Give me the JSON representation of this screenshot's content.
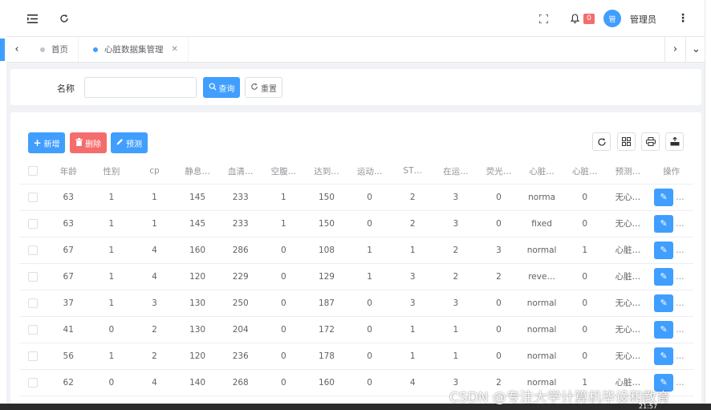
{
  "header": {
    "menu_icon": "hamburger-icon",
    "refresh_icon": "refresh-icon",
    "fullscreen_icon": "fullscreen-icon",
    "bell_icon": "bell-icon",
    "notification_count": "0",
    "avatar_text": "管",
    "username": "管理员",
    "more_icon": "vertical-dots-icon"
  },
  "tabs": [
    {
      "label": "首页",
      "active": false
    },
    {
      "label": "心脏数据集管理",
      "active": true
    }
  ],
  "search": {
    "label": "名称",
    "input_value": "",
    "input_placeholder": "",
    "query_button": "查询",
    "reset_button": "重置"
  },
  "toolbar": {
    "add_button": "新增",
    "delete_button": "删除",
    "predict_button": "预测"
  },
  "table": {
    "columns": [
      "年龄",
      "性别",
      "cp",
      "静息…",
      "血清…",
      "空腹…",
      "达到…",
      "运动…",
      "ST…",
      "在运…",
      "荧光…",
      "心脏…",
      "心脏…",
      "预测…",
      "操作"
    ],
    "rows": [
      [
        "63",
        "1",
        "1",
        "145",
        "233",
        "1",
        "150",
        "0",
        "2",
        "3",
        "0",
        "norma",
        "0",
        "无心…"
      ],
      [
        "63",
        "1",
        "1",
        "145",
        "233",
        "1",
        "150",
        "0",
        "2",
        "3",
        "0",
        "fixed",
        "0",
        "无心…"
      ],
      [
        "67",
        "1",
        "4",
        "160",
        "286",
        "0",
        "108",
        "1",
        "1",
        "2",
        "3",
        "normal",
        "1",
        "心脏…"
      ],
      [
        "67",
        "1",
        "4",
        "120",
        "229",
        "0",
        "129",
        "1",
        "3",
        "2",
        "2",
        "reve…",
        "0",
        "心脏…"
      ],
      [
        "37",
        "1",
        "3",
        "130",
        "250",
        "0",
        "187",
        "0",
        "3",
        "3",
        "0",
        "normal",
        "0",
        "无心…"
      ],
      [
        "41",
        "0",
        "2",
        "130",
        "204",
        "0",
        "172",
        "0",
        "1",
        "1",
        "0",
        "normal",
        "0",
        "无心…"
      ],
      [
        "56",
        "1",
        "2",
        "120",
        "236",
        "0",
        "178",
        "0",
        "1",
        "1",
        "0",
        "normal",
        "0",
        "无心…"
      ],
      [
        "62",
        "0",
        "4",
        "140",
        "268",
        "0",
        "160",
        "0",
        "4",
        "3",
        "2",
        "normal",
        "1",
        "心脏…"
      ]
    ]
  },
  "overlay": {
    "watermark": "CSDN @专注大学计算机毕设和教育",
    "clock": "21:57"
  },
  "colors": {
    "primary": "#409eff",
    "danger": "#f56c6c",
    "background": "#f0f2f5"
  }
}
